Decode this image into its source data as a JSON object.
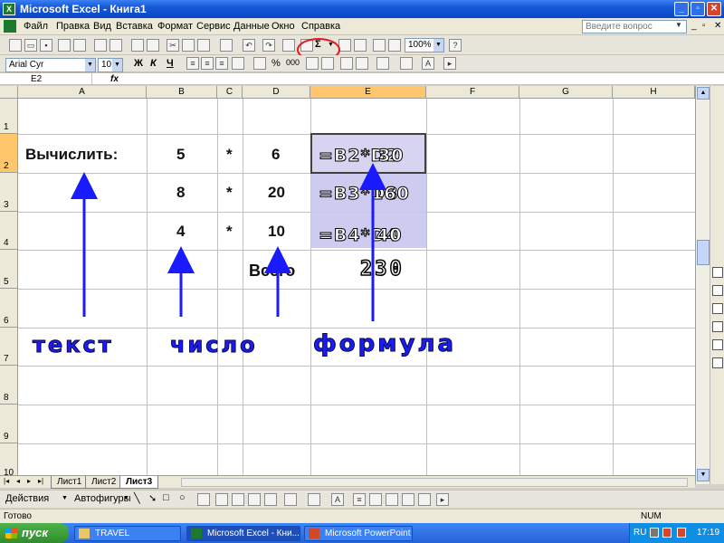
{
  "window": {
    "title": "Microsoft Excel - Книга1",
    "app_icon": "excel-icon"
  },
  "menu": [
    "Файл",
    "Правка",
    "Вид",
    "Вставка",
    "Формат",
    "Сервис",
    "Данные",
    "Окно",
    "Справка"
  ],
  "help_box": {
    "placeholder": "Введите вопрос"
  },
  "toolbar": {
    "zoom": "100%",
    "font_name": "Arial Cyr",
    "font_size": "10",
    "bold": "Ж",
    "italic": "К",
    "underline": "Ч",
    "percent": "%",
    "thousands": "000",
    "sum_symbol": "Σ",
    "highlight_color": "#e8141a"
  },
  "formula_bar": {
    "name_box": "E2",
    "fx_label": "fx",
    "content": ""
  },
  "columns": [
    "A",
    "B",
    "C",
    "D",
    "E",
    "F",
    "G",
    "H"
  ],
  "rows": [
    "1",
    "2",
    "3",
    "4",
    "5",
    "6",
    "7",
    "8",
    "9",
    "10"
  ],
  "cells": {
    "A2": "Вычислить:",
    "B2": "5",
    "C2": "*",
    "D2": "6",
    "B3": "8",
    "C3": "*",
    "D3": "20",
    "B4": "4",
    "C4": "*",
    "D4": "10",
    "D5": "Всего"
  },
  "overlays": {
    "e2_formula": "=B2*D2",
    "e2_result": "30",
    "e3_formula": "=B3*D3",
    "e3_result": "160",
    "e4_formula": "=B4*D4",
    "e4_result": "40",
    "total": "230",
    "label_text": "текст",
    "label_number": "число",
    "label_formula": "формула",
    "arrow_color": "#1a1aff"
  },
  "sheet_tabs": [
    "Лист1",
    "Лист2",
    "Лист3"
  ],
  "active_sheet": "Лист3",
  "drawing_toolbar": {
    "actions": "Действия",
    "autoshapes": "Автофигуры"
  },
  "status": {
    "left": "Готово",
    "num": "NUM"
  },
  "taskbar": {
    "start": "пуск",
    "tasks": [
      "TRAVEL",
      "Microsoft Excel - Кни...",
      "Microsoft PowerPoint ..."
    ],
    "lang": "RU",
    "clock": "17:19"
  }
}
